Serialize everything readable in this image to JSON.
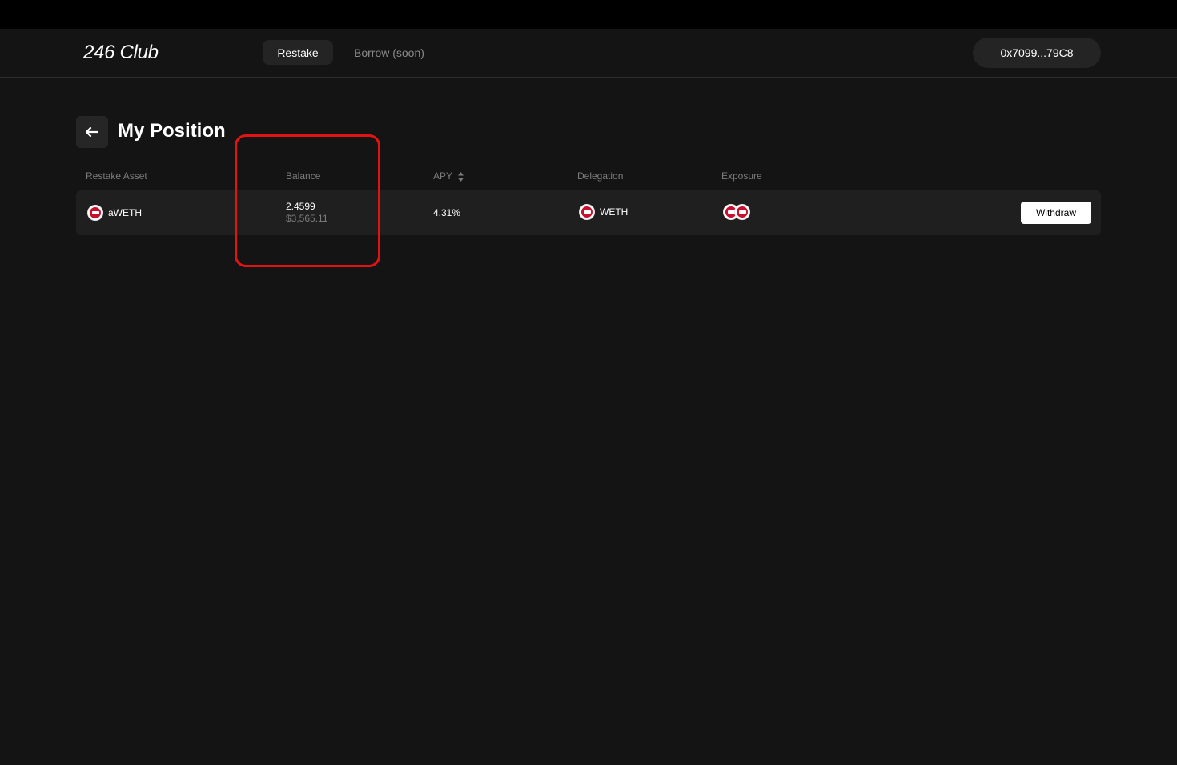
{
  "header": {
    "logo": "246 Club",
    "nav": {
      "restake": "Restake",
      "borrow": "Borrow (soon)"
    },
    "wallet": "0x7099...79C8"
  },
  "page": {
    "title": "My Position"
  },
  "table": {
    "columns": {
      "asset": "Restake Asset",
      "balance": "Balance",
      "apy": "APY",
      "delegation": "Delegation",
      "exposure": "Exposure"
    },
    "rows": [
      {
        "asset": "aWETH",
        "balance": "2.4599",
        "balance_usd": "$3,565.11",
        "apy": "4.31%",
        "delegation": "WETH",
        "action": "Withdraw"
      }
    ]
  },
  "icons": {
    "back": "arrow-left-icon",
    "sort": "sort-icon",
    "token": "weth-token-icon"
  },
  "colors": {
    "background": "#141414",
    "highlight": "#e31313",
    "token_red": "#c8102e"
  }
}
